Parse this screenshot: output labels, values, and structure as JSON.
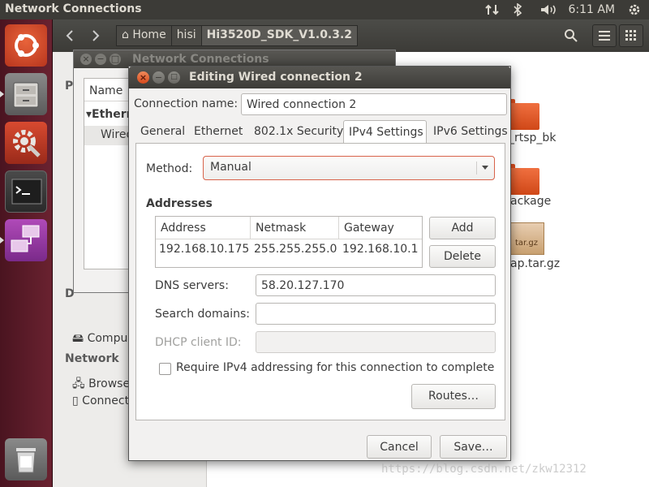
{
  "top_panel": {
    "title": "Network Connections",
    "clock": "6:11 AM",
    "icons": [
      "network-arrows-icon",
      "bluetooth-icon",
      "volume-icon",
      "power-gear-icon"
    ]
  },
  "launcher": {
    "items": [
      "ubuntu-dash-icon",
      "files-icon",
      "system-settings-icon",
      "terminal-icon",
      "network-manager-icon",
      "trash-icon"
    ]
  },
  "files_window": {
    "breadcrumbs": [
      "Home",
      "hisi",
      "Hi3520D_SDK_V1.0.3.2"
    ],
    "sidebar": {
      "partial_header_top": "P",
      "partial_header_d": "D",
      "computer_label": "Compu",
      "network_header": "Network",
      "browse_label": "Browse",
      "connect_label": "Connect"
    },
    "files": [
      {
        "name": "_rtsp_bk",
        "kind": "folder"
      },
      {
        "name": "ackage",
        "kind": "folder"
      },
      {
        "name": "ap.tar.gz",
        "kind": "archive",
        "icon_text": "tar.gz"
      }
    ]
  },
  "nc_window": {
    "title": "Network Connections",
    "list_header": "Name",
    "group": "Etherne",
    "item": "Wired"
  },
  "dialog": {
    "title": "Editing Wired connection 2",
    "connection_name_label": "Connection name:",
    "connection_name": "Wired connection 2",
    "tabs": [
      {
        "label": "General",
        "active": false
      },
      {
        "label": "Ethernet",
        "active": false
      },
      {
        "label": "802.1x Security",
        "active": false
      },
      {
        "label": "IPv4 Settings",
        "active": true
      },
      {
        "label": "IPv6 Settings",
        "active": false
      }
    ],
    "method_label": "Method:",
    "method_value": "Manual",
    "addresses_heading": "Addresses",
    "addresses_columns": [
      "Address",
      "Netmask",
      "Gateway"
    ],
    "addresses_rows": [
      [
        "192.168.10.175",
        "255.255.255.0",
        "192.168.10.1"
      ]
    ],
    "add_label": "Add",
    "delete_label": "Delete",
    "dns_label": "DNS servers:",
    "dns_value": "58.20.127.170",
    "search_domains_label": "Search domains:",
    "search_domains_value": "",
    "dhcp_client_label": "DHCP client ID:",
    "dhcp_client_value": "",
    "require_ipv4_label": "Require IPv4 addressing for this connection to complete",
    "require_ipv4_checked": false,
    "routes_label": "Routes…",
    "cancel_label": "Cancel",
    "save_label": "Save…"
  },
  "watermark": "https://blog.csdn.net/zkw12312",
  "colors": {
    "panel": "#3c3b37",
    "launcher": "#5c1c28",
    "accent": "#e95420",
    "folder": "#f07040"
  }
}
